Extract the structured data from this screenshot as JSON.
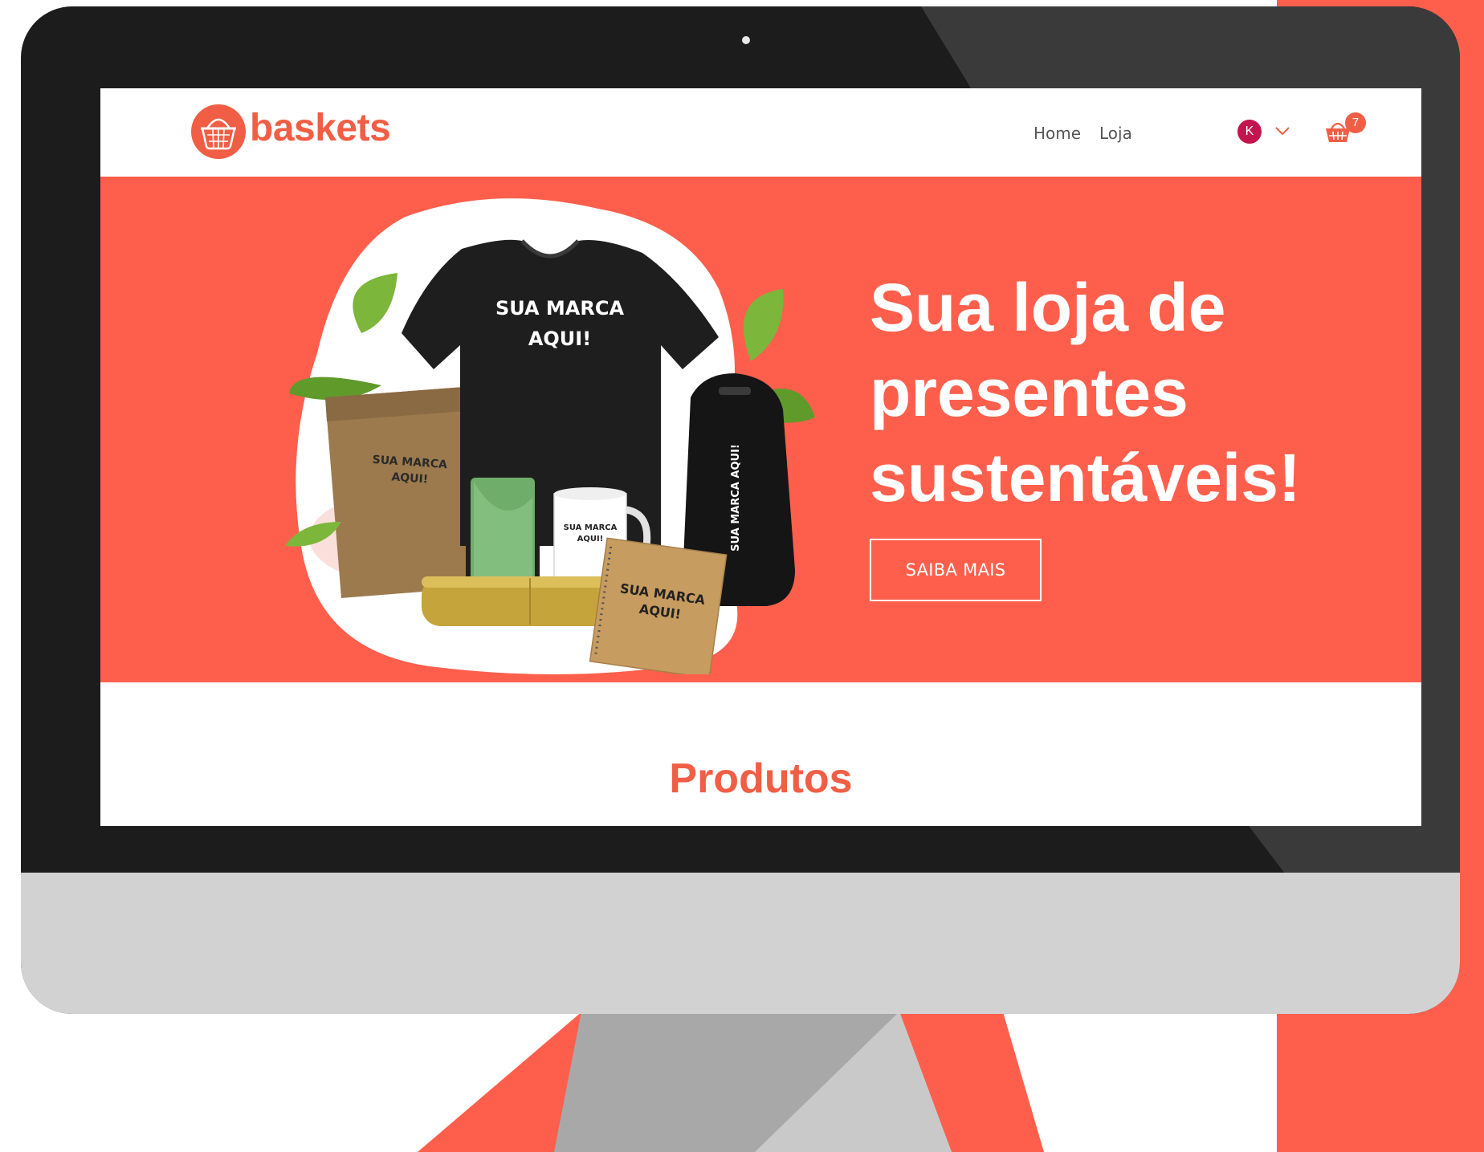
{
  "colors": {
    "brand": "#f05e45",
    "hero_background": "#fe5f4c",
    "avatar": "#c4164e",
    "bezel": "#1c1c1c",
    "chin": "#d2d2d3"
  },
  "header": {
    "logo_text": "baskets",
    "logo_icon": "basket-icon",
    "nav": {
      "home": "Home",
      "loja": "Loja"
    },
    "account": {
      "avatar_initial": "K",
      "menu_icon": "chevron-down-icon"
    },
    "cart": {
      "icon": "cart-icon",
      "count": "7"
    }
  },
  "hero": {
    "headline": "Sua loja de presentes sustentáveis!",
    "cta_label": "SAIBA MAIS",
    "image": {
      "tshirt_text_line1": "SUA MARCA",
      "tshirt_text_line2": "AQUI!",
      "bag_text_line1": "SUA MARCA",
      "bag_text_line2": "AQUI!",
      "mug_text_line1": "SUA MARCA",
      "mug_text_line2": "AQUI!",
      "notebook_text_line1": "SUA MARCA",
      "notebook_text_line2": "AQUI!",
      "backpack_text": "SUA MARCA AQUI!"
    }
  },
  "products": {
    "title": "Produtos"
  }
}
